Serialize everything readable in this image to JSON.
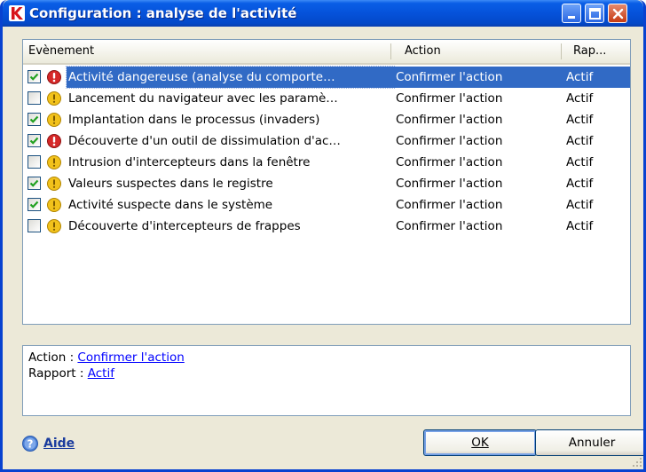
{
  "window": {
    "title": "Configuration : analyse de l'activité"
  },
  "columns": {
    "event": "Evènement",
    "action": "Action",
    "report": "Rap..."
  },
  "rows": [
    {
      "checked": true,
      "severity": "danger-icon",
      "event": "Activité dangereuse (analyse du comporte…",
      "action": "Confirmer l'action",
      "report": "Actif",
      "selected": true
    },
    {
      "checked": false,
      "severity": "warning-icon",
      "event": "Lancement du navigateur avec les paramè…",
      "action": "Confirmer l'action",
      "report": "Actif",
      "selected": false
    },
    {
      "checked": true,
      "severity": "warning-icon",
      "event": "Implantation dans le processus (invaders)",
      "action": "Confirmer l'action",
      "report": "Actif",
      "selected": false
    },
    {
      "checked": true,
      "severity": "danger-icon",
      "event": "Découverte d'un outil de dissimulation d'ac…",
      "action": "Confirmer l'action",
      "report": "Actif",
      "selected": false
    },
    {
      "checked": false,
      "severity": "warning-icon",
      "event": "Intrusion d'intercepteurs dans la fenêtre",
      "action": "Confirmer l'action",
      "report": "Actif",
      "selected": false
    },
    {
      "checked": true,
      "severity": "warning-icon",
      "event": "Valeurs suspectes dans le registre",
      "action": "Confirmer l'action",
      "report": "Actif",
      "selected": false
    },
    {
      "checked": true,
      "severity": "warning-icon",
      "event": "Activité suspecte dans le système",
      "action": "Confirmer l'action",
      "report": "Actif",
      "selected": false
    },
    {
      "checked": false,
      "severity": "warning-icon",
      "event": "Découverte d'intercepteurs de frappes",
      "action": "Confirmer l'action",
      "report": "Actif",
      "selected": false
    }
  ],
  "details": {
    "action_label": "Action : ",
    "action_value": "Confirmer l'action",
    "report_label": "Rapport : ",
    "report_value": "Actif"
  },
  "footer": {
    "help": "Aide",
    "ok": "OK",
    "cancel": "Annuler"
  },
  "colors": {
    "titlebar": "#0552da",
    "selection": "#316ac5",
    "danger": "#d62828",
    "warning": "#f2c21b"
  }
}
